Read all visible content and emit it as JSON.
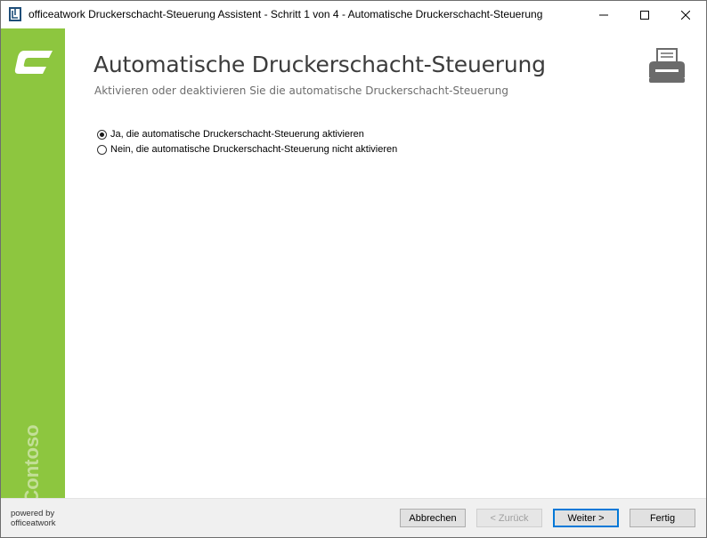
{
  "window": {
    "title": "officeatwork Druckerschacht-Steuerung Assistent - Schritt 1 von 4 - Automatische Druckerschacht-Steuerung"
  },
  "sidebar": {
    "logo_letter": "C",
    "brand": "Contoso",
    "color": "#8dc63f"
  },
  "header": {
    "title": "Automatische Druckerschacht-Steuerung",
    "subtitle": "Aktivieren oder deaktivieren Sie die automatische Druckerschacht-Steuerung",
    "icon": "printer-icon"
  },
  "options": [
    {
      "label": "Ja, die automatische Druckerschacht-Steuerung aktivieren",
      "selected": true
    },
    {
      "label": "Nein, die automatische Druckerschacht-Steuerung nicht aktivieren",
      "selected": false
    }
  ],
  "footer": {
    "powered_line1": "powered by",
    "powered_line2": "officeatwork",
    "cancel_label": "Abbrechen",
    "back_label": "< Zurück",
    "next_label": "Weiter >",
    "finish_label": "Fertig"
  }
}
